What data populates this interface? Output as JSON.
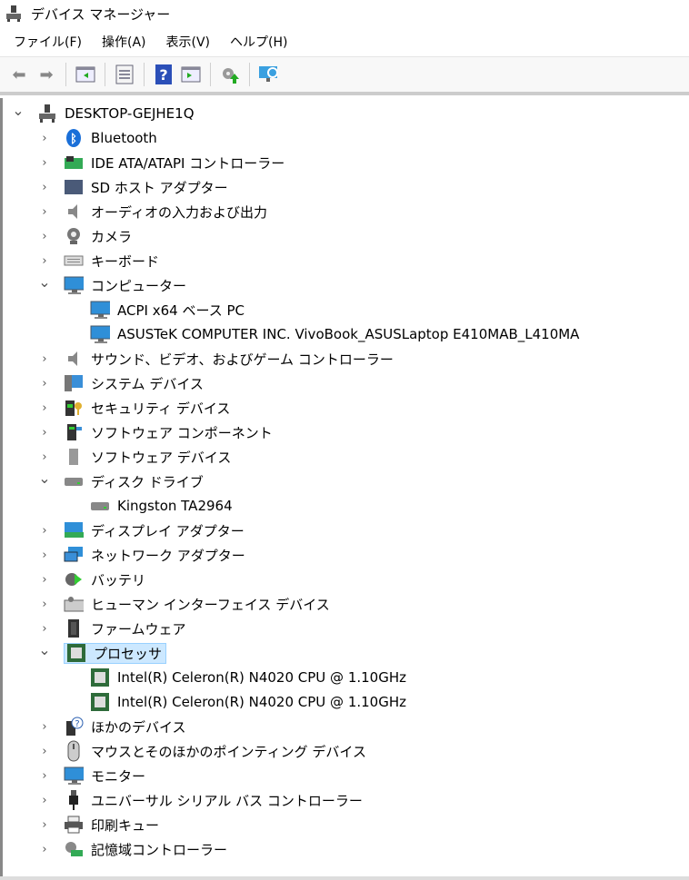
{
  "window": {
    "title": "デバイス マネージャー"
  },
  "menu": [
    "ファイル(F)",
    "操作(A)",
    "表示(V)",
    "ヘルプ(H)"
  ],
  "toolbar": [
    "back-icon",
    "forward-icon",
    "show-hide-console-tree-icon",
    "properties-icon",
    "help-icon",
    "action-pane-icon",
    "update-driver-icon",
    "scan-hardware-icon"
  ],
  "tree": [
    {
      "label": "DESKTOP-GEJHE1Q",
      "level": 0,
      "state": "expanded",
      "icon": "computer-root"
    },
    {
      "label": "Bluetooth",
      "level": 1,
      "state": "collapsed",
      "icon": "bluetooth"
    },
    {
      "label": "IDE ATA/ATAPI コントローラー",
      "level": 1,
      "state": "collapsed",
      "icon": "ide"
    },
    {
      "label": "SD ホスト アダプター",
      "level": 1,
      "state": "collapsed",
      "icon": "sd"
    },
    {
      "label": "オーディオの入力および出力",
      "level": 1,
      "state": "collapsed",
      "icon": "speaker"
    },
    {
      "label": "カメラ",
      "level": 1,
      "state": "collapsed",
      "icon": "camera"
    },
    {
      "label": "キーボード",
      "level": 1,
      "state": "collapsed",
      "icon": "keyboard"
    },
    {
      "label": "コンピューター",
      "level": 1,
      "state": "expanded",
      "icon": "monitor"
    },
    {
      "label": "ACPI x64 ベース PC",
      "level": 2,
      "state": "leaf",
      "icon": "monitor"
    },
    {
      "label": "ASUSTeK COMPUTER INC. VivoBook_ASUSLaptop E410MAB_L410MA",
      "level": 2,
      "state": "leaf",
      "icon": "monitor"
    },
    {
      "label": "サウンド、ビデオ、およびゲーム コントローラー",
      "level": 1,
      "state": "collapsed",
      "icon": "speaker"
    },
    {
      "label": "システム デバイス",
      "level": 1,
      "state": "collapsed",
      "icon": "system"
    },
    {
      "label": "セキュリティ デバイス",
      "level": 1,
      "state": "collapsed",
      "icon": "security"
    },
    {
      "label": "ソフトウェア コンポーネント",
      "level": 1,
      "state": "collapsed",
      "icon": "software-component"
    },
    {
      "label": "ソフトウェア デバイス",
      "level": 1,
      "state": "collapsed",
      "icon": "software-device"
    },
    {
      "label": "ディスク ドライブ",
      "level": 1,
      "state": "expanded",
      "icon": "disk"
    },
    {
      "label": "Kingston TA2964",
      "level": 2,
      "state": "leaf",
      "icon": "disk"
    },
    {
      "label": "ディスプレイ アダプター",
      "level": 1,
      "state": "collapsed",
      "icon": "display"
    },
    {
      "label": "ネットワーク アダプター",
      "level": 1,
      "state": "collapsed",
      "icon": "network"
    },
    {
      "label": "バッテリ",
      "level": 1,
      "state": "collapsed",
      "icon": "battery"
    },
    {
      "label": "ヒューマン インターフェイス デバイス",
      "level": 1,
      "state": "collapsed",
      "icon": "hid"
    },
    {
      "label": "ファームウェア",
      "level": 1,
      "state": "collapsed",
      "icon": "firmware"
    },
    {
      "label": "プロセッサ",
      "level": 1,
      "state": "expanded",
      "icon": "cpu",
      "selected": true
    },
    {
      "label": "Intel(R) Celeron(R) N4020 CPU @ 1.10GHz",
      "level": 2,
      "state": "leaf",
      "icon": "cpu"
    },
    {
      "label": "Intel(R) Celeron(R) N4020 CPU @ 1.10GHz",
      "level": 2,
      "state": "leaf",
      "icon": "cpu"
    },
    {
      "label": "ほかのデバイス",
      "level": 1,
      "state": "collapsed",
      "icon": "other"
    },
    {
      "label": "マウスとそのほかのポインティング デバイス",
      "level": 1,
      "state": "collapsed",
      "icon": "mouse"
    },
    {
      "label": "モニター",
      "level": 1,
      "state": "collapsed",
      "icon": "monitor"
    },
    {
      "label": "ユニバーサル シリアル バス コントローラー",
      "level": 1,
      "state": "collapsed",
      "icon": "usb"
    },
    {
      "label": "印刷キュー",
      "level": 1,
      "state": "collapsed",
      "icon": "printer"
    },
    {
      "label": "記憶域コントローラー",
      "level": 1,
      "state": "collapsed",
      "icon": "storage"
    }
  ]
}
